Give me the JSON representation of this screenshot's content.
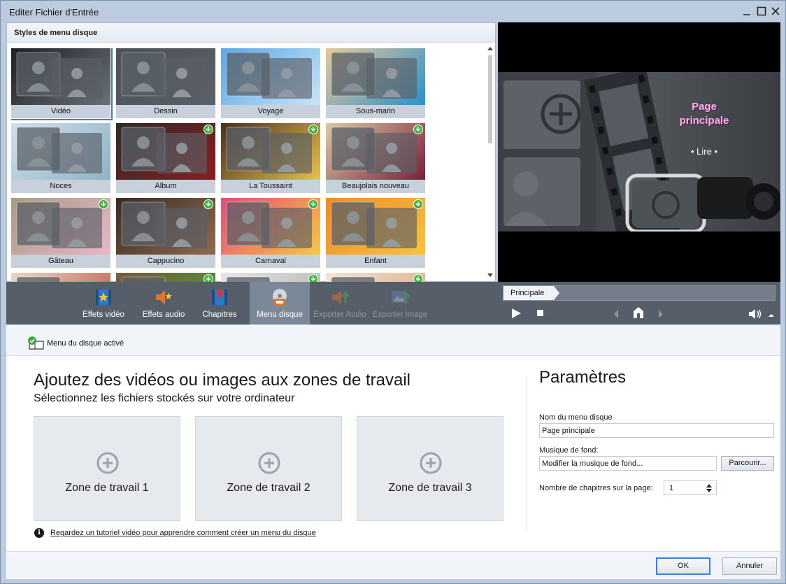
{
  "window": {
    "title": "Editer Fichier d'Entrée",
    "minimize_icon": "minimize-icon",
    "maximize_icon": "maximize-icon",
    "close_icon": "close-icon"
  },
  "styles_panel": {
    "header": "Styles de menu disque",
    "items": [
      {
        "label": "Vidéo",
        "selected": true,
        "download": false,
        "colors": [
          "#1d2024",
          "#6b7077"
        ]
      },
      {
        "label": "Dessin",
        "selected": false,
        "download": false,
        "colors": [
          "#4b5156",
          "#5a6066"
        ]
      },
      {
        "label": "Voyage",
        "selected": false,
        "download": false,
        "colors": [
          "#5aa7e6",
          "#c9e4f6"
        ]
      },
      {
        "label": "Sous-marin",
        "selected": false,
        "download": false,
        "colors": [
          "#e6c89a",
          "#2d8fc9"
        ]
      },
      {
        "label": "Noces",
        "selected": false,
        "download": false,
        "colors": [
          "#cfe0ea",
          "#8fb3c7"
        ]
      },
      {
        "label": "Album",
        "selected": false,
        "download": true,
        "colors": [
          "#2b2b2b",
          "#8a1d1d"
        ]
      },
      {
        "label": "La Toussaint",
        "selected": false,
        "download": true,
        "colors": [
          "#4a2f22",
          "#e6c14a"
        ]
      },
      {
        "label": "Beaujolais nouveau",
        "selected": false,
        "download": true,
        "colors": [
          "#d9c9a6",
          "#7a1f3a"
        ]
      },
      {
        "label": "Gâteau",
        "selected": false,
        "download": true,
        "colors": [
          "#a89b83",
          "#e9b7c9"
        ]
      },
      {
        "label": "Cappucino",
        "selected": false,
        "download": true,
        "colors": [
          "#3b2a22",
          "#8c6b52"
        ]
      },
      {
        "label": "Carnaval",
        "selected": false,
        "download": true,
        "colors": [
          "#e84a7a",
          "#f5c842"
        ]
      },
      {
        "label": "Enfant",
        "selected": false,
        "download": true,
        "colors": [
          "#f08a2a",
          "#f6c33f"
        ]
      },
      {
        "label": "",
        "selected": false,
        "download": false,
        "colors": [
          "#e9d9c9",
          "#b94a3a"
        ]
      },
      {
        "label": "",
        "selected": false,
        "download": true,
        "colors": [
          "#7a5a3a",
          "#4a9a3a"
        ]
      },
      {
        "label": "",
        "selected": false,
        "download": true,
        "colors": [
          "#e6e6e6",
          "#b0b0b0"
        ]
      },
      {
        "label": "",
        "selected": false,
        "download": true,
        "colors": [
          "#f2e6d9",
          "#d9a47a"
        ]
      }
    ]
  },
  "preview": {
    "page_title": "Page principale",
    "play_label": "• Lire •"
  },
  "toolbar": {
    "tools": [
      {
        "label": "Effets vidéo",
        "icon": "video-effects-icon",
        "active": false,
        "disabled": false
      },
      {
        "label": "Effets audio",
        "icon": "audio-effects-icon",
        "active": false,
        "disabled": false
      },
      {
        "label": "Chapitres",
        "icon": "chapters-icon",
        "active": false,
        "disabled": false
      },
      {
        "label": "Menu disque",
        "icon": "disc-menu-icon",
        "active": true,
        "disabled": false
      },
      {
        "label": "Exporter Audio",
        "icon": "export-audio-icon",
        "active": false,
        "disabled": true
      },
      {
        "label": "Exporter Image",
        "icon": "export-image-icon",
        "active": false,
        "disabled": true
      }
    ],
    "breadcrumb": "Principale"
  },
  "content": {
    "menu_active_label": "Menu du disque activé",
    "menu_active_checked": true,
    "heading": "Ajoutez des vidéos ou images aux zones de travail",
    "subheading": "Sélectionnez les fichiers stockés sur votre ordinateur",
    "zones": [
      "Zone de travail 1",
      "Zone de travail 2",
      "Zone de travail 3"
    ],
    "tutorial_link": "Regardez un tutoriel vidéo pour apprendre comment créer un menu du disque"
  },
  "params": {
    "title": "Paramètres",
    "menu_name_label": "Nom du menu disque",
    "menu_name_value": "Page principale",
    "music_label": "Musique de fond:",
    "music_value": "Modifier la musique de fond...",
    "browse_label": "Parcourir...",
    "chapters_label": "Nombre de chapitres sur la page:",
    "chapters_value": "1"
  },
  "footer": {
    "ok_label": "OK",
    "cancel_label": "Annuler"
  }
}
